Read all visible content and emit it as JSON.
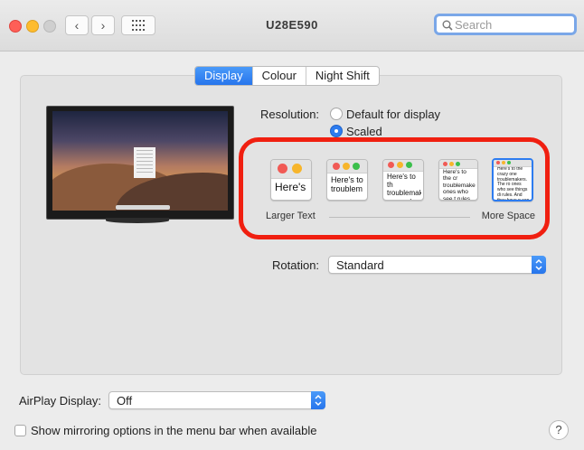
{
  "window": {
    "title": "U28E590"
  },
  "search": {
    "placeholder": "Search"
  },
  "tabs": [
    {
      "label": "Display",
      "active": true
    },
    {
      "label": "Colour",
      "active": false
    },
    {
      "label": "Night Shift",
      "active": false
    }
  ],
  "resolution": {
    "label": "Resolution:",
    "options": [
      {
        "label": "Default for display",
        "selected": false
      },
      {
        "label": "Scaled",
        "selected": true
      }
    ]
  },
  "scaling": {
    "thumbnails": [
      {
        "text": "Here's",
        "selected": false
      },
      {
        "text": "Here's to troublem",
        "selected": false
      },
      {
        "text": "Here's to th troublemak ones who s",
        "selected": false
      },
      {
        "text": "Here's to the cr troublemakers. ones who see t rules. And they",
        "selected": false
      },
      {
        "text": "Here's to the crazy one troublemakers. The ro ones who see things di rules. And they have n can quote them, disag them. About the only th Because they change t",
        "selected": true
      }
    ],
    "left_label": "Larger Text",
    "right_label": "More Space"
  },
  "rotation": {
    "label": "Rotation:",
    "value": "Standard"
  },
  "airplay": {
    "label": "AirPlay Display:",
    "value": "Off"
  },
  "mirroring": {
    "label": "Show mirroring options in the menu bar when available",
    "checked": false
  },
  "help": {
    "label": "?"
  },
  "colors": {
    "accent": "#2d7cf0",
    "highlight_outline": "#f01f10"
  }
}
